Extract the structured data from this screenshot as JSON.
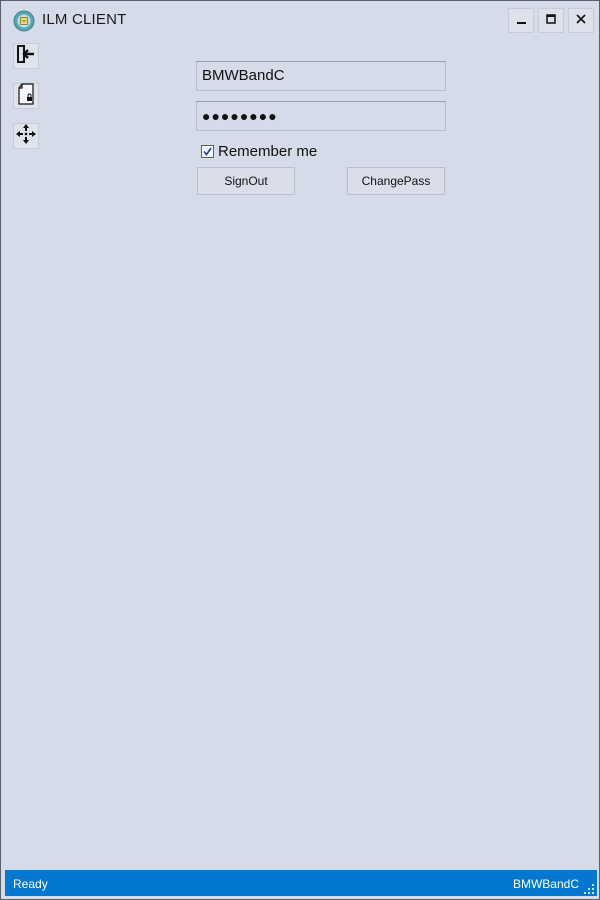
{
  "window": {
    "title": "ILM CLIENT",
    "app_icon": "app-logo-icon",
    "controls": [
      "minimize-icon",
      "maximize-icon",
      "close-icon"
    ]
  },
  "sidebar": {
    "items": [
      {
        "icon": "sign-out-icon"
      },
      {
        "icon": "locked-document-icon"
      },
      {
        "icon": "move-arrows-icon"
      }
    ]
  },
  "login": {
    "username": "BMWBandC",
    "password_mask": "●●●●●●●●",
    "remember_checked": true,
    "remember_label": "Remember me",
    "signout_label": "SignOut",
    "changepass_label": "ChangePass"
  },
  "statusbar": {
    "status": "Ready",
    "user": "BMWBandC"
  },
  "colors": {
    "background": "#d6dbe9",
    "statusbar": "#0478d0"
  }
}
